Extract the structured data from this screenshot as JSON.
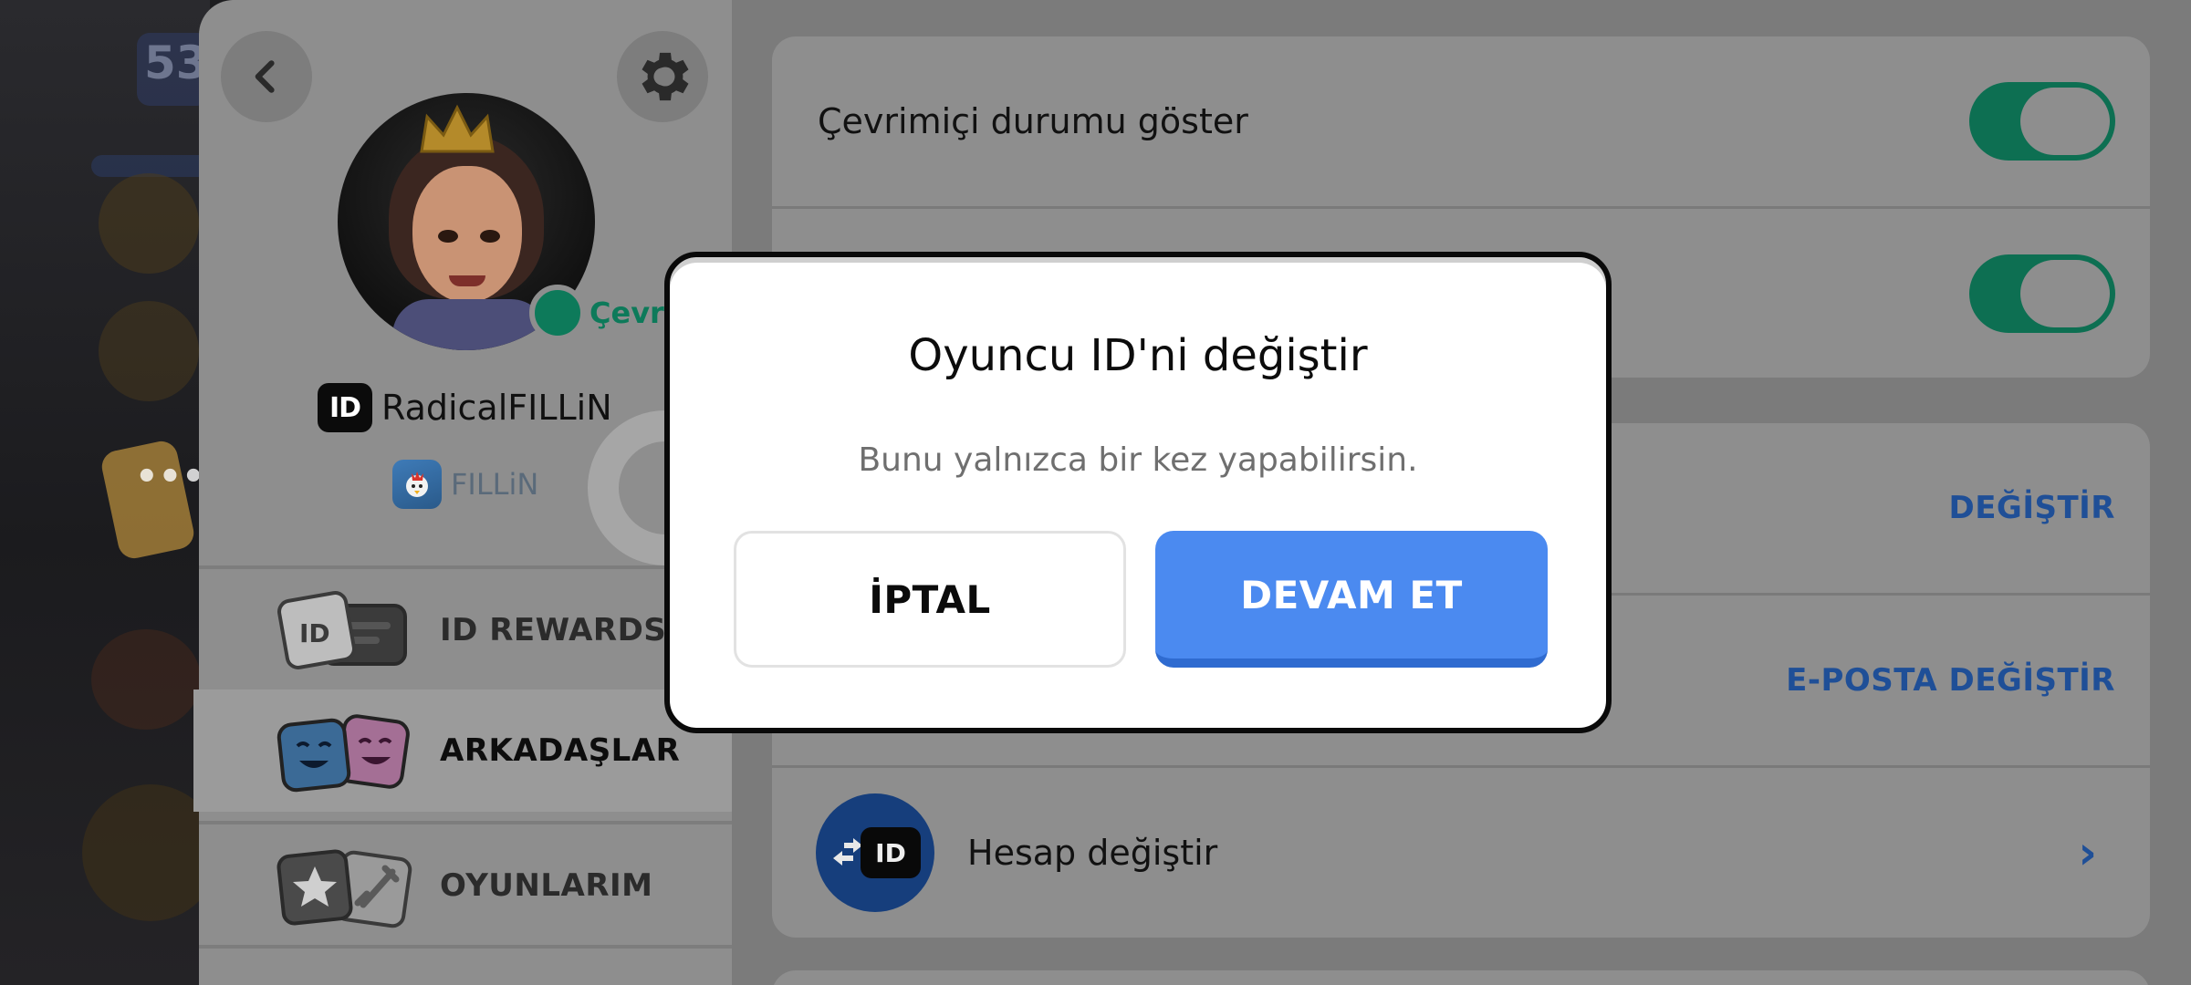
{
  "profile": {
    "status_text": "Çevri",
    "player_id_badge": "ID",
    "player_name": "RadicalFILLiN",
    "game_name": "FILLiN",
    "level": "53"
  },
  "menu": {
    "items": [
      {
        "label": "ID REWARDS",
        "icon": "id-cards-icon"
      },
      {
        "label": "ARKADAŞLAR",
        "icon": "friends-faces-icon"
      },
      {
        "label": "OYUNLARIM",
        "icon": "star-sword-icon"
      }
    ]
  },
  "settings": {
    "online_status_label": "Çevrimiçi durumu göster",
    "change_action": "DEĞİŞTİR",
    "change_email_action": "E-POSTA DEĞİŞTİR",
    "switch_account_label": "Hesap değiştir",
    "switch_account_id_badge": "ID",
    "chevron": "›"
  },
  "dialog": {
    "title": "Oyuncu ID'ni değiştir",
    "subtitle": "Bunu yalnızca bir kez yapabilirsin.",
    "cancel_label": "İPTAL",
    "continue_label": "DEVAM ET"
  },
  "colors": {
    "accent_green": "#1aa27a",
    "accent_blue": "#4b8af0",
    "link_blue": "#2d6fd6"
  }
}
